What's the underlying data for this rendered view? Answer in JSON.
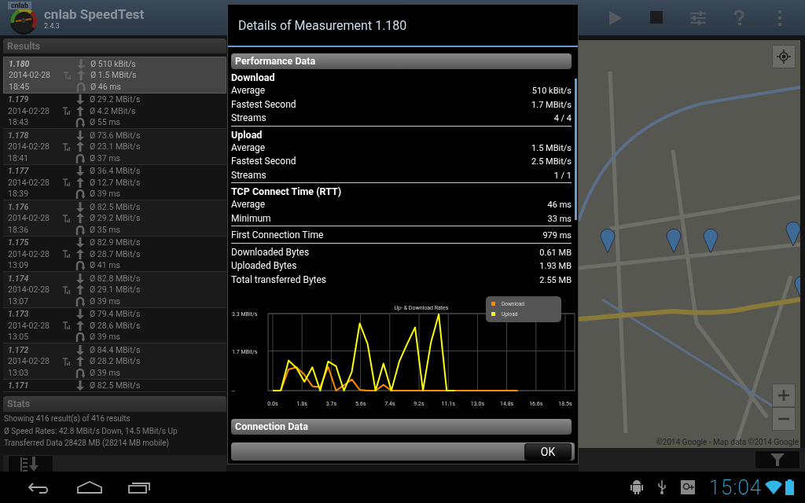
{
  "app_bar": {
    "logo_text": "cnlab",
    "title": "cnlab SpeedTest",
    "version": "2.4.3"
  },
  "results": {
    "title": "Results",
    "rows": [
      {
        "id": "1.180",
        "date": "2014-02-28",
        "time": "18:45",
        "down": "Ø 510 kBit/s",
        "up": "Ø 1.5 MBit/s",
        "ping": "Ø 46 ms",
        "selected": true
      },
      {
        "id": "1.179",
        "date": "2014-02-28",
        "time": "18:43",
        "down": "Ø 29.2 MBit/s",
        "up": "Ø 4.2 MBit/s",
        "ping": "Ø 55 ms",
        "selected": false
      },
      {
        "id": "1.178",
        "date": "2014-02-28",
        "time": "18:41",
        "down": "Ø 73.6 MBit/s",
        "up": "Ø 23.1 MBit/s",
        "ping": "Ø 37 ms",
        "selected": false
      },
      {
        "id": "1.177",
        "date": "2014-02-28",
        "time": "18:39",
        "down": "Ø 36.4 MBit/s",
        "up": "Ø 12.7 MBit/s",
        "ping": "Ø 39 ms",
        "selected": false
      },
      {
        "id": "1.176",
        "date": "2014-02-28",
        "time": "18:36",
        "down": "Ø 82.5 MBit/s",
        "up": "Ø 29.2 MBit/s",
        "ping": "Ø 35 ms",
        "selected": false
      },
      {
        "id": "1.175",
        "date": "2014-02-28",
        "time": "13:09",
        "down": "Ø 82.9 MBit/s",
        "up": "Ø 28.7 MBit/s",
        "ping": "Ø 41 ms",
        "selected": false
      },
      {
        "id": "1.174",
        "date": "2014-02-28",
        "time": "13:07",
        "down": "Ø 82.8 MBit/s",
        "up": "Ø 29.1 MBit/s",
        "ping": "Ø 39 ms",
        "selected": false
      },
      {
        "id": "1.173",
        "date": "2014-02-28",
        "time": "13:05",
        "down": "Ø 79.4 MBit/s",
        "up": "Ø 28.6 MBit/s",
        "ping": "Ø 39 ms",
        "selected": false
      },
      {
        "id": "1.172",
        "date": "2014-02-28",
        "time": "13:03",
        "down": "Ø 84.4 MBit/s",
        "up": "Ø 28.2 MBit/s",
        "ping": "Ø 39 ms",
        "selected": false
      },
      {
        "id": "1.171",
        "down": "Ø 82.5 MBit/s",
        "selected": false
      }
    ]
  },
  "stats": {
    "title": "Stats",
    "lines": [
      "Showing 416 result(s) of 416 results",
      "Ø Speed Rates: 42.8 MBit/s Down, 14.5 MBit/s Up",
      "Transferred Data 28428 MB (28214 MB mobile)"
    ]
  },
  "map": {
    "copyright": "©2014 Google - Map data ©2014 Google"
  },
  "dialog": {
    "title": "Details of Measurement 1.180",
    "section": "Performance Data",
    "groups": [
      {
        "heading": "Download",
        "rows": [
          {
            "label": "Average",
            "value": "510 kBit/s"
          },
          {
            "label": "Fastest Second",
            "value": "1.7 MBit/s"
          },
          {
            "label": "Streams",
            "value": "4 / 4"
          }
        ]
      },
      {
        "heading": "Upload",
        "rows": [
          {
            "label": "Average",
            "value": "1.5 MBit/s"
          },
          {
            "label": "Fastest Second",
            "value": "2.5 MBit/s"
          },
          {
            "label": "Streams",
            "value": "1 / 1"
          }
        ]
      },
      {
        "heading": "TCP Connect Time (RTT)",
        "rows": [
          {
            "label": "Average",
            "value": "46 ms"
          },
          {
            "label": "Minimum",
            "value": "33 ms"
          }
        ]
      },
      {
        "rows": [
          {
            "label": "First Connection Time",
            "value": "979 ms"
          }
        ]
      },
      {
        "rows": [
          {
            "label": "Downloaded Bytes",
            "value": "0.61 MB"
          },
          {
            "label": "Uploaded Bytes",
            "value": "1.93 MB"
          },
          {
            "label": "Total transferred Bytes",
            "value": "2.55 MB"
          }
        ]
      }
    ],
    "chart_data": {
      "type": "line",
      "title": "Up- & Download Rates",
      "x": [
        0,
        0.5,
        1,
        1.5,
        2,
        2.5,
        3,
        3.5,
        4,
        4.5,
        5,
        5.5,
        6,
        6.5,
        7,
        7.5,
        8,
        8.5,
        9,
        9.5,
        10,
        10.5,
        11,
        11.5,
        12,
        12.5,
        13,
        13.5,
        14,
        14.5,
        15,
        15.5
      ],
      "series": [
        {
          "name": "Download",
          "color": "#ff8c00",
          "values": [
            null,
            0,
            0.91,
            1.0,
            0.68,
            0.19,
            0.15,
            1.02,
            0,
            0.23,
            0.48,
            0.03,
            0,
            0,
            0.25,
            0,
            0,
            0,
            0,
            0,
            0,
            0,
            0,
            0,
            0,
            0,
            0,
            0,
            0,
            0,
            0,
            0
          ]
        },
        {
          "name": "Upload",
          "color": "#ffff00",
          "values": [
            0,
            0,
            1.29,
            0.97,
            0.38,
            1.0,
            0,
            1.25,
            1.05,
            0,
            0.8,
            2.88,
            2.0,
            0,
            1.16,
            0,
            1.25,
            2.0,
            2.71,
            0,
            2.05,
            3.27,
            0,
            0,
            null,
            null,
            null,
            null,
            null,
            null,
            null,
            null
          ]
        }
      ],
      "xlim": [
        0,
        18.5
      ],
      "ylim": [
        0,
        3.3
      ],
      "grid": true,
      "legend": true,
      "xticks": [
        {
          "value": 0,
          "label": "0.0s"
        },
        {
          "value": 1.85,
          "label": "1.8s"
        },
        {
          "value": 3.7,
          "label": "3.7s"
        },
        {
          "value": 5.55,
          "label": "5.6s"
        },
        {
          "value": 7.4,
          "label": "7.4s"
        },
        {
          "value": 9.25,
          "label": "9.2s"
        },
        {
          "value": 11.1,
          "label": "11.1s"
        },
        {
          "value": 12.95,
          "label": "13.0s"
        },
        {
          "value": 14.8,
          "label": "14.8s"
        },
        {
          "value": 16.65,
          "label": "16.6s"
        },
        {
          "value": 18.5,
          "label": "18.5s"
        }
      ],
      "yticks": [
        {
          "value": 0,
          "label": "--"
        },
        {
          "value": 1.7,
          "label": "1.7 MBit/s"
        },
        {
          "value": 3.3,
          "label": "3.3 MBit/s"
        }
      ]
    },
    "next_section": "Connection Data",
    "ok": "OK"
  },
  "status_bar": {
    "time": "15:04"
  }
}
